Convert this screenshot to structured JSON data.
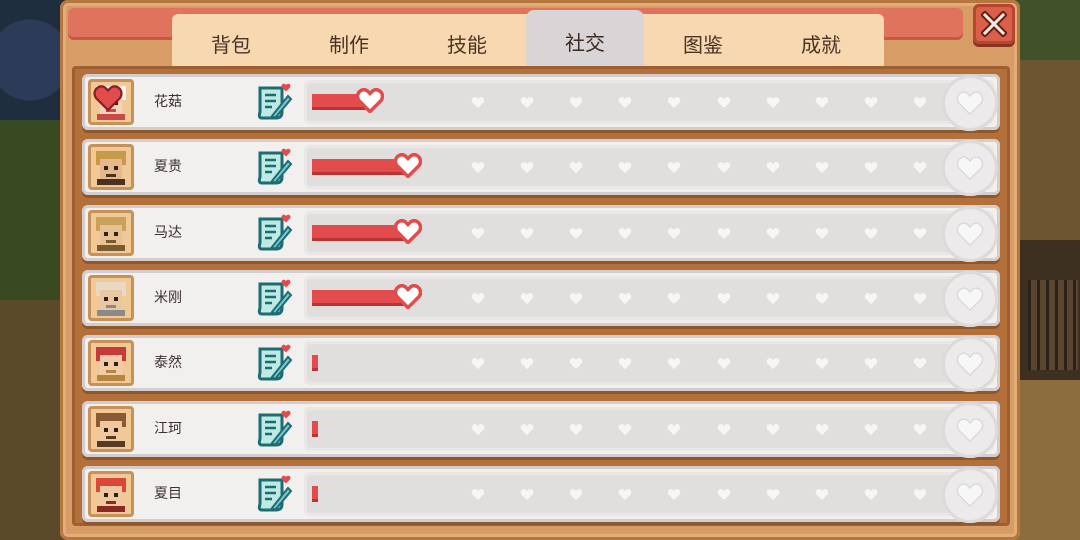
{
  "tabs": [
    {
      "label": "背包",
      "active": false
    },
    {
      "label": "制作",
      "active": false
    },
    {
      "label": "技能",
      "active": false
    },
    {
      "label": "社交",
      "active": true
    },
    {
      "label": "图鉴",
      "active": false
    },
    {
      "label": "成就",
      "active": false
    }
  ],
  "close_icon": "close-x-icon",
  "colors": {
    "panel": "#d89d66",
    "friendship_fill": "#e34c4c",
    "tab_active": "#d9d4d6",
    "close_button": "#d9614c"
  },
  "friendship_max_hearts": 11,
  "villagers": [
    {
      "name": "花菇",
      "fill_fraction": 0.09,
      "hearts": 1,
      "gifted": true,
      "avatar": "white-hair-girl",
      "letter_icon": "letter-heart-icon"
    },
    {
      "name": "夏贵",
      "fill_fraction": 0.15,
      "hearts": 1,
      "gifted": false,
      "avatar": "straw-hat-farmer",
      "letter_icon": "letter-heart-icon"
    },
    {
      "name": "马达",
      "fill_fraction": 0.15,
      "hearts": 1,
      "gifted": false,
      "avatar": "blond-man",
      "letter_icon": "letter-heart-icon"
    },
    {
      "name": "米刚",
      "fill_fraction": 0.15,
      "hearts": 1,
      "gifted": false,
      "avatar": "bald-old-man",
      "letter_icon": "letter-heart-icon"
    },
    {
      "name": "泰然",
      "fill_fraction": 0.01,
      "hearts": 0,
      "gifted": false,
      "avatar": "red-bandana-girl",
      "letter_icon": "letter-heart-icon"
    },
    {
      "name": "江珂",
      "fill_fraction": 0.01,
      "hearts": 0,
      "gifted": false,
      "avatar": "brown-hair-boy",
      "letter_icon": "letter-heart-icon"
    },
    {
      "name": "夏目",
      "fill_fraction": 0.01,
      "hearts": 0,
      "gifted": false,
      "avatar": "red-hair-kid",
      "letter_icon": "letter-heart-icon"
    }
  ]
}
